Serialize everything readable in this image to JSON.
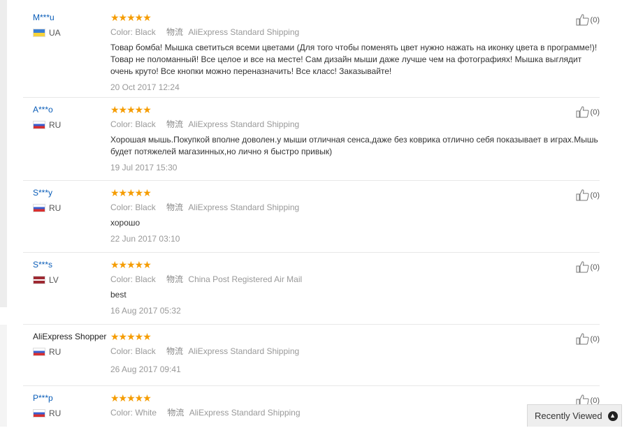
{
  "colors": {
    "accent_link": "#0a5db8",
    "star": "#f59c00"
  },
  "reviews": [
    {
      "user": "M***u",
      "flag": "ua",
      "country": "UA",
      "rating": 5,
      "color_label": "Color:",
      "color_value": "Black",
      "ship_label": "物流",
      "shipping": "AliExpress Standard Shipping",
      "text": "Товар бомба! Мышка светиться всеми цветами (Для того чтобы поменять цвет нужно нажать на иконку цвета в программе!)! Товар не поломанный! Все целое и все на месте! Сам дизайн мыши даже лучше чем на фотографиях! Мышка выглядит очень круто! Все кнопки можно переназначить! Все класс! Заказывайте!",
      "date": "20 Oct 2017 12:24",
      "useful": "(0)"
    },
    {
      "user": "A***o",
      "flag": "ru",
      "country": "RU",
      "rating": 5,
      "color_label": "Color:",
      "color_value": "Black",
      "ship_label": "物流",
      "shipping": "AliExpress Standard Shipping",
      "text": "Хорошая мышь.Покупкой вполне доволен.у мыши отличная сенса,даже без коврика отлично себя показывает в играх.Мышь будет потяжелей магазинных,но лично я быстро привык)",
      "date": "19 Jul 2017 15:30",
      "useful": "(0)"
    },
    {
      "user": "S***y",
      "flag": "ru",
      "country": "RU",
      "rating": 5,
      "color_label": "Color:",
      "color_value": "Black",
      "ship_label": "物流",
      "shipping": "AliExpress Standard Shipping",
      "text": "хорошо",
      "date": "22 Jun 2017 03:10",
      "useful": "(0)"
    },
    {
      "user": "S***s",
      "flag": "lv",
      "country": "LV",
      "rating": 5,
      "color_label": "Color:",
      "color_value": "Black",
      "ship_label": "物流",
      "shipping": "China Post Registered Air Mail",
      "text": "best",
      "date": "16 Aug 2017 05:32",
      "useful": "(0)"
    },
    {
      "user": "AliExpress Shopper",
      "flag": "ru",
      "country": "RU",
      "rating": 5,
      "color_label": "Color:",
      "color_value": "Black",
      "ship_label": "物流",
      "shipping": "AliExpress Standard Shipping",
      "text": "",
      "date": "26 Aug 2017 09:41",
      "useful": "(0)"
    },
    {
      "user": "P***p",
      "flag": "ru",
      "country": "RU",
      "rating": 5,
      "color_label": "Color:",
      "color_value": "White",
      "ship_label": "物流",
      "shipping": "AliExpress Standard Shipping",
      "text": "",
      "date": "",
      "useful": "(0)"
    }
  ],
  "recently_viewed": "Recently Viewed"
}
